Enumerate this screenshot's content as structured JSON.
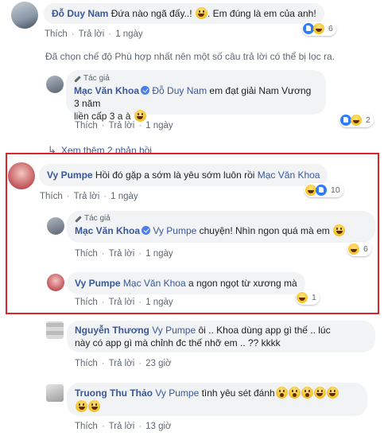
{
  "comments": [
    {
      "author": "Đỗ Duy Nam",
      "text": "Đứa nào ngã đấy..! ",
      "text2": ". Em đúng là em của anh!",
      "actions": {
        "like": "Thích",
        "reply": "Trả lời",
        "time": "1 ngày"
      },
      "reaction_count": "6"
    },
    {
      "author": "Vy Pumpe",
      "text": "Hồi đó gặp a sớm là yêu sớm luôn rồi",
      "mention": "Mạc Văn Khoa",
      "actions": {
        "like": "Thích",
        "reply": "Trả lời",
        "time": "1 ngày"
      },
      "reaction_count": "10"
    },
    {
      "author": "Nguyễn Thương",
      "mention": "Vy Pumpe",
      "text_line1": " ôi .. Khoa dùng app gì thế .. lúc",
      "text_line2": "này có app gì mà chỉnh đc thế nhỡ em .. ?? kkkk",
      "actions": {
        "like": "Thích",
        "reply": "Trả lời",
        "time": "23 giờ"
      }
    },
    {
      "author": "Truong Thu Thảo",
      "mention": "Vy Pumpe",
      "text": "tình yêu sét đánh",
      "actions": {
        "like": "Thích",
        "reply": "Trả lời",
        "time": "13 giờ"
      }
    }
  ],
  "filter_notice": "Đã chọn chế độ Phù hợp nhất nên một số câu trả lời có thể bị lọc ra.",
  "replies": [
    {
      "author_badge": "Tác giả",
      "author": "Mạc Văn Khoa",
      "mention": "Đỗ Duy Nam",
      "text_line1": " em đạt giải Nam Vương 3 năm",
      "text_line2": "liền cấp 3 a à ",
      "actions": {
        "like": "Thích",
        "reply": "Trả lời",
        "time": "1 ngày"
      },
      "reaction_count": "2"
    },
    {
      "author_badge": "Tác giả",
      "author": "Mạc Văn Khoa",
      "mention": "Vy Pumpe",
      "text": " chuyện! Nhìn ngon quá mà em ",
      "actions": {
        "like": "Thích",
        "reply": "Trả lời",
        "time": "1 ngày"
      },
      "reaction_count": "6"
    },
    {
      "author": "Vy Pumpe",
      "mention": "Mạc Văn Khoa",
      "text": " a ngon ngọt từ xương mà",
      "actions": {
        "like": "Thích",
        "reply": "Trả lời",
        "time": "1 ngày"
      },
      "reaction_count": "1"
    }
  ],
  "view_more": "Xem thêm 2 phản hồi",
  "colors": {
    "link": "#385898",
    "highlight": "#d9252b",
    "bubble": "#f2f3f5"
  }
}
